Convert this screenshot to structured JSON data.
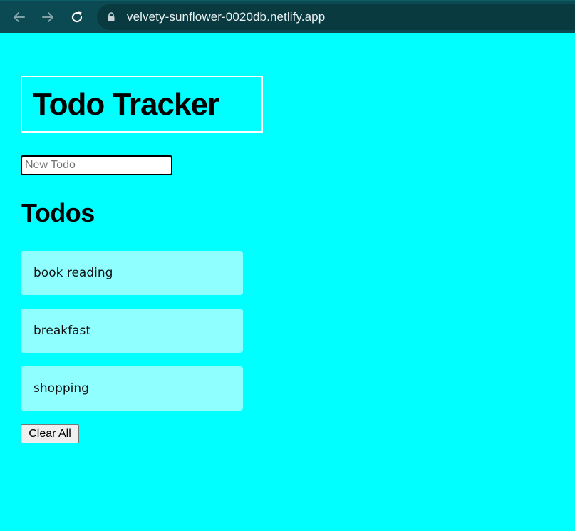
{
  "browser": {
    "url": "velvety-sunflower-0020db.netlify.app",
    "back_icon": "arrow-left-icon",
    "forward_icon": "arrow-right-icon",
    "reload_icon": "reload-icon",
    "lock_icon": "lock-icon"
  },
  "app": {
    "title": "Todo Tracker",
    "new_todo_placeholder": "New Todo",
    "new_todo_value": "",
    "list_heading": "Todos",
    "todos": [
      {
        "label": "book reading"
      },
      {
        "label": "breakfast"
      },
      {
        "label": "shopping"
      }
    ],
    "clear_label": "Clear All"
  },
  "colors": {
    "page_background": "#00ffff",
    "todo_item_background": "#90ffff",
    "browser_bar": "#0b4a52",
    "address_pill": "#083a40"
  }
}
